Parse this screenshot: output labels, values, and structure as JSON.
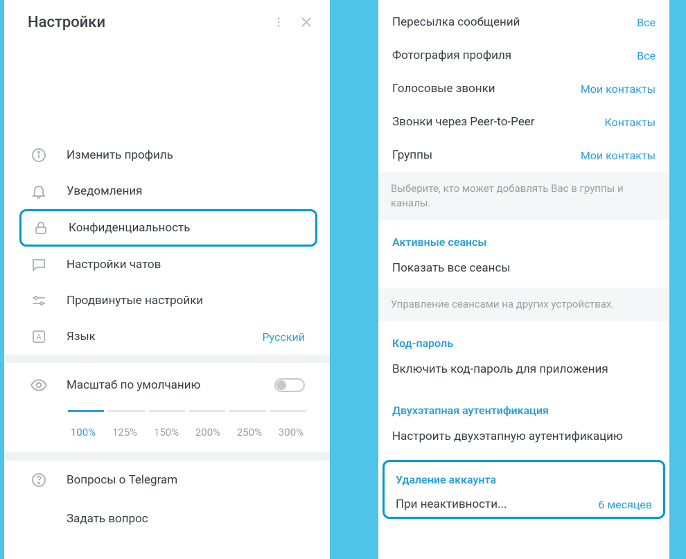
{
  "left": {
    "title": "Настройки",
    "items": {
      "edit_profile": "Изменить профиль",
      "notifications": "Уведомления",
      "privacy": "Конфиденциальность",
      "chat_settings": "Настройки чатов",
      "advanced": "Продвинутые настройки",
      "language": "Язык",
      "language_value": "Русский"
    },
    "zoom": {
      "label": "Масштаб по умолчанию",
      "options": [
        "100%",
        "125%",
        "150%",
        "200%",
        "250%",
        "300%"
      ],
      "active_index": 0
    },
    "faq": "Вопросы о Telegram",
    "ask": "Задать вопрос"
  },
  "right": {
    "rows": [
      {
        "label": "Пересылка сообщений",
        "value": "Все"
      },
      {
        "label": "Фотография профиля",
        "value": "Все"
      },
      {
        "label": "Голосовые звонки",
        "value": "Мои контакты"
      },
      {
        "label": "Звонки через Peer-to-Peer",
        "value": "Контакты"
      },
      {
        "label": "Группы",
        "value": "Мои контакты"
      }
    ],
    "groups_hint": "Выберите, кто может добавлять Вас в группы и каналы.",
    "sessions_head": "Активные сеансы",
    "sessions_show_all": "Показать все сеансы",
    "sessions_hint": "Управление сеансами на других устройствах.",
    "passcode_head": "Код-пароль",
    "passcode_item": "Включить код-пароль для приложения",
    "twofa_head": "Двухэтапная аутентификация",
    "twofa_item": "Настроить двухэтапную аутентификацию",
    "delete_head": "Удаление аккаунта",
    "delete_label": "При неактивности...",
    "delete_value": "6 месяцев"
  }
}
